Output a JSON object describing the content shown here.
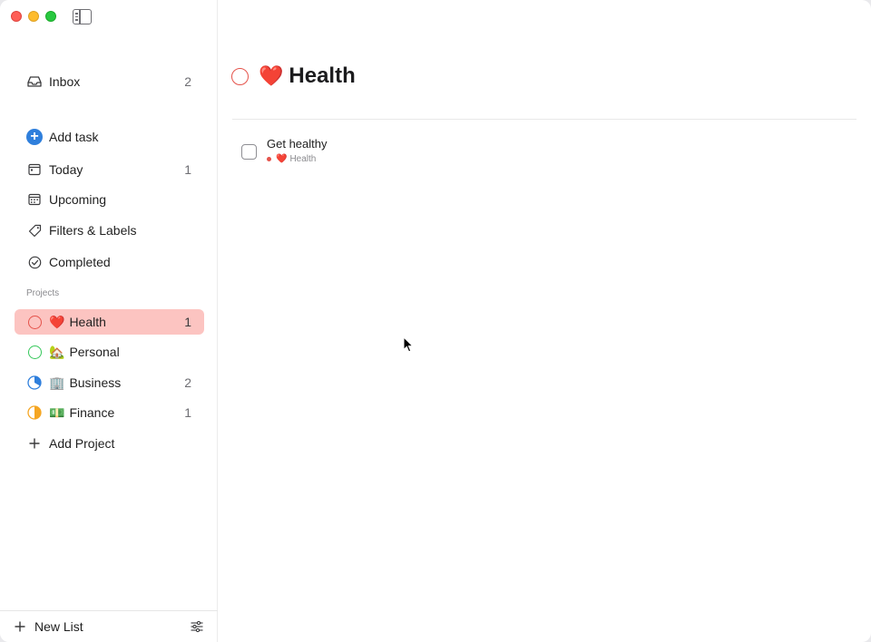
{
  "sidebar": {
    "inbox": {
      "label": "Inbox",
      "count": "2"
    },
    "add_task": {
      "label": "Add task"
    },
    "today": {
      "label": "Today",
      "count": "1"
    },
    "upcoming": {
      "label": "Upcoming"
    },
    "filters": {
      "label": "Filters & Labels"
    },
    "completed": {
      "label": "Completed"
    },
    "projects_heading": "Projects",
    "projects": [
      {
        "emoji": "❤️",
        "label": "Health",
        "count": "1",
        "color": "#e5534b",
        "progress": 0
      },
      {
        "emoji": "🏡",
        "label": "Personal",
        "count": "",
        "color": "#34c759",
        "progress": 0
      },
      {
        "emoji": "🏢",
        "label": "Business",
        "count": "2",
        "color": "#2f7fdc",
        "progress": 0.33
      },
      {
        "emoji": "💵",
        "label": "Finance",
        "count": "1",
        "color": "#f5a623",
        "progress": 0.5
      }
    ],
    "add_project": {
      "label": "Add Project"
    },
    "footer": {
      "new_list": "New List"
    }
  },
  "main": {
    "title_emoji": "❤️",
    "title": "Health",
    "tasks": [
      {
        "name": "Get healthy",
        "project_emoji": "❤️",
        "project": "Health"
      }
    ]
  }
}
